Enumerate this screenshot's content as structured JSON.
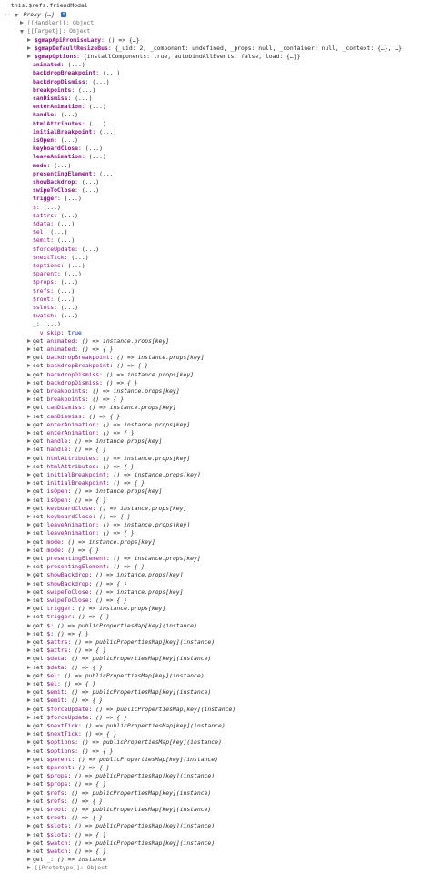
{
  "console": {
    "command": "this.$refs.friendModal",
    "return_arrow": "‹·",
    "proxy_label": "Proxy {…}",
    "info_glyph": "i",
    "handler_label": "[[Handler]]: Object",
    "target_label": "[[Target]]: Object",
    "prototype_label": "[[Prototype]]: Object"
  },
  "target_props": [
    {
      "kind": "fn",
      "key": "$gmapApiPromiseLazy",
      "value": "() => {…}"
    },
    {
      "kind": "obj",
      "key": "$gmapDefaultResizeBus",
      "value": "{_uid: 2, _component: undefined, _props: null, _container: null, _context: {…}, …}"
    },
    {
      "kind": "obj",
      "key": "$gmapOptions",
      "value": "{installComponents: true, autobindAllEvents: false, load: {…}}"
    },
    {
      "kind": "own",
      "key": "animated",
      "value": "(...)"
    },
    {
      "kind": "own",
      "key": "backdropBreakpoint",
      "value": "(...)"
    },
    {
      "kind": "own",
      "key": "backdropDismiss",
      "value": "(...)"
    },
    {
      "kind": "own",
      "key": "breakpoints",
      "value": "(...)"
    },
    {
      "kind": "own",
      "key": "canDismiss",
      "value": "(...)"
    },
    {
      "kind": "own",
      "key": "enterAnimation",
      "value": "(...)"
    },
    {
      "kind": "own",
      "key": "handle",
      "value": "(...)"
    },
    {
      "kind": "own",
      "key": "htmlAttributes",
      "value": "(...)"
    },
    {
      "kind": "own",
      "key": "initialBreakpoint",
      "value": "(...)"
    },
    {
      "kind": "own",
      "key": "isOpen",
      "value": "(...)"
    },
    {
      "kind": "own",
      "key": "keyboardClose",
      "value": "(...)"
    },
    {
      "kind": "own",
      "key": "leaveAnimation",
      "value": "(...)"
    },
    {
      "kind": "own",
      "key": "mode",
      "value": "(...)"
    },
    {
      "kind": "own",
      "key": "presentingElement",
      "value": "(...)"
    },
    {
      "kind": "own",
      "key": "showBackdrop",
      "value": "(...)"
    },
    {
      "kind": "own",
      "key": "swipeToClose",
      "value": "(...)"
    },
    {
      "kind": "own",
      "key": "trigger",
      "value": "(...)"
    },
    {
      "kind": "int",
      "key": "$",
      "value": "(...)"
    },
    {
      "kind": "int",
      "key": "$attrs",
      "value": "(...)"
    },
    {
      "kind": "int",
      "key": "$data",
      "value": "(...)"
    },
    {
      "kind": "int",
      "key": "$el",
      "value": "(...)"
    },
    {
      "kind": "int",
      "key": "$emit",
      "value": "(...)"
    },
    {
      "kind": "int",
      "key": "$forceUpdate",
      "value": "(...)"
    },
    {
      "kind": "int",
      "key": "$nextTick",
      "value": "(...)"
    },
    {
      "kind": "int",
      "key": "$options",
      "value": "(...)"
    },
    {
      "kind": "int",
      "key": "$parent",
      "value": "(...)"
    },
    {
      "kind": "int",
      "key": "$props",
      "value": "(...)"
    },
    {
      "kind": "int",
      "key": "$refs",
      "value": "(...)"
    },
    {
      "kind": "int",
      "key": "$root",
      "value": "(...)"
    },
    {
      "kind": "int",
      "key": "$slots",
      "value": "(...)"
    },
    {
      "kind": "int",
      "key": "$watch",
      "value": "(...)"
    },
    {
      "kind": "int",
      "key": "_",
      "value": "(...)"
    },
    {
      "kind": "skip",
      "key": "__v_skip",
      "value": "true"
    }
  ],
  "accessors": [
    {
      "prefix": "get",
      "key": "animated",
      "value": "() => instance.props[key]"
    },
    {
      "prefix": "set",
      "key": "animated",
      "value": "() => { }"
    },
    {
      "prefix": "get",
      "key": "backdropBreakpoint",
      "value": "() => instance.props[key]"
    },
    {
      "prefix": "set",
      "key": "backdropBreakpoint",
      "value": "() => { }"
    },
    {
      "prefix": "get",
      "key": "backdropDismiss",
      "value": "() => instance.props[key]"
    },
    {
      "prefix": "set",
      "key": "backdropDismiss",
      "value": "() => { }"
    },
    {
      "prefix": "get",
      "key": "breakpoints",
      "value": "() => instance.props[key]"
    },
    {
      "prefix": "set",
      "key": "breakpoints",
      "value": "() => { }"
    },
    {
      "prefix": "get",
      "key": "canDismiss",
      "value": "() => instance.props[key]"
    },
    {
      "prefix": "set",
      "key": "canDismiss",
      "value": "() => { }"
    },
    {
      "prefix": "get",
      "key": "enterAnimation",
      "value": "() => instance.props[key]"
    },
    {
      "prefix": "set",
      "key": "enterAnimation",
      "value": "() => { }"
    },
    {
      "prefix": "get",
      "key": "handle",
      "value": "() => instance.props[key]"
    },
    {
      "prefix": "set",
      "key": "handle",
      "value": "() => { }"
    },
    {
      "prefix": "get",
      "key": "htmlAttributes",
      "value": "() => instance.props[key]"
    },
    {
      "prefix": "set",
      "key": "htmlAttributes",
      "value": "() => { }"
    },
    {
      "prefix": "get",
      "key": "initialBreakpoint",
      "value": "() => instance.props[key]"
    },
    {
      "prefix": "set",
      "key": "initialBreakpoint",
      "value": "() => { }"
    },
    {
      "prefix": "get",
      "key": "isOpen",
      "value": "() => instance.props[key]"
    },
    {
      "prefix": "set",
      "key": "isOpen",
      "value": "() => { }"
    },
    {
      "prefix": "get",
      "key": "keyboardClose",
      "value": "() => instance.props[key]"
    },
    {
      "prefix": "set",
      "key": "keyboardClose",
      "value": "() => { }"
    },
    {
      "prefix": "get",
      "key": "leaveAnimation",
      "value": "() => instance.props[key]"
    },
    {
      "prefix": "set",
      "key": "leaveAnimation",
      "value": "() => { }"
    },
    {
      "prefix": "get",
      "key": "mode",
      "value": "() => instance.props[key]"
    },
    {
      "prefix": "set",
      "key": "mode",
      "value": "() => { }"
    },
    {
      "prefix": "get",
      "key": "presentingElement",
      "value": "() => instance.props[key]"
    },
    {
      "prefix": "set",
      "key": "presentingElement",
      "value": "() => { }"
    },
    {
      "prefix": "get",
      "key": "showBackdrop",
      "value": "() => instance.props[key]"
    },
    {
      "prefix": "set",
      "key": "showBackdrop",
      "value": "() => { }"
    },
    {
      "prefix": "get",
      "key": "swipeToClose",
      "value": "() => instance.props[key]"
    },
    {
      "prefix": "set",
      "key": "swipeToClose",
      "value": "() => { }"
    },
    {
      "prefix": "get",
      "key": "trigger",
      "value": "() => instance.props[key]"
    },
    {
      "prefix": "set",
      "key": "trigger",
      "value": "() => { }"
    },
    {
      "prefix": "get",
      "key": "$",
      "value": "() => publicPropertiesMap[key](instance)"
    },
    {
      "prefix": "set",
      "key": "$",
      "value": "() => { }"
    },
    {
      "prefix": "get",
      "key": "$attrs",
      "value": "() => publicPropertiesMap[key](instance)"
    },
    {
      "prefix": "set",
      "key": "$attrs",
      "value": "() => { }"
    },
    {
      "prefix": "get",
      "key": "$data",
      "value": "() => publicPropertiesMap[key](instance)"
    },
    {
      "prefix": "set",
      "key": "$data",
      "value": "() => { }"
    },
    {
      "prefix": "get",
      "key": "$el",
      "value": "() => publicPropertiesMap[key](instance)"
    },
    {
      "prefix": "set",
      "key": "$el",
      "value": "() => { }"
    },
    {
      "prefix": "get",
      "key": "$emit",
      "value": "() => publicPropertiesMap[key](instance)"
    },
    {
      "prefix": "set",
      "key": "$emit",
      "value": "() => { }"
    },
    {
      "prefix": "get",
      "key": "$forceUpdate",
      "value": "() => publicPropertiesMap[key](instance)"
    },
    {
      "prefix": "set",
      "key": "$forceUpdate",
      "value": "() => { }"
    },
    {
      "prefix": "get",
      "key": "$nextTick",
      "value": "() => publicPropertiesMap[key](instance)"
    },
    {
      "prefix": "set",
      "key": "$nextTick",
      "value": "() => { }"
    },
    {
      "prefix": "get",
      "key": "$options",
      "value": "() => publicPropertiesMap[key](instance)"
    },
    {
      "prefix": "set",
      "key": "$options",
      "value": "() => { }"
    },
    {
      "prefix": "get",
      "key": "$parent",
      "value": "() => publicPropertiesMap[key](instance)"
    },
    {
      "prefix": "set",
      "key": "$parent",
      "value": "() => { }"
    },
    {
      "prefix": "get",
      "key": "$props",
      "value": "() => publicPropertiesMap[key](instance)"
    },
    {
      "prefix": "set",
      "key": "$props",
      "value": "() => { }"
    },
    {
      "prefix": "get",
      "key": "$refs",
      "value": "() => publicPropertiesMap[key](instance)"
    },
    {
      "prefix": "set",
      "key": "$refs",
      "value": "() => { }"
    },
    {
      "prefix": "get",
      "key": "$root",
      "value": "() => publicPropertiesMap[key](instance)"
    },
    {
      "prefix": "set",
      "key": "$root",
      "value": "() => { }"
    },
    {
      "prefix": "get",
      "key": "$slots",
      "value": "() => publicPropertiesMap[key](instance)"
    },
    {
      "prefix": "set",
      "key": "$slots",
      "value": "() => { }"
    },
    {
      "prefix": "get",
      "key": "$watch",
      "value": "() => publicPropertiesMap[key](instance)"
    },
    {
      "prefix": "set",
      "key": "$watch",
      "value": "() => { }"
    },
    {
      "prefix": "get",
      "key": "_",
      "value": "() => instance"
    }
  ]
}
